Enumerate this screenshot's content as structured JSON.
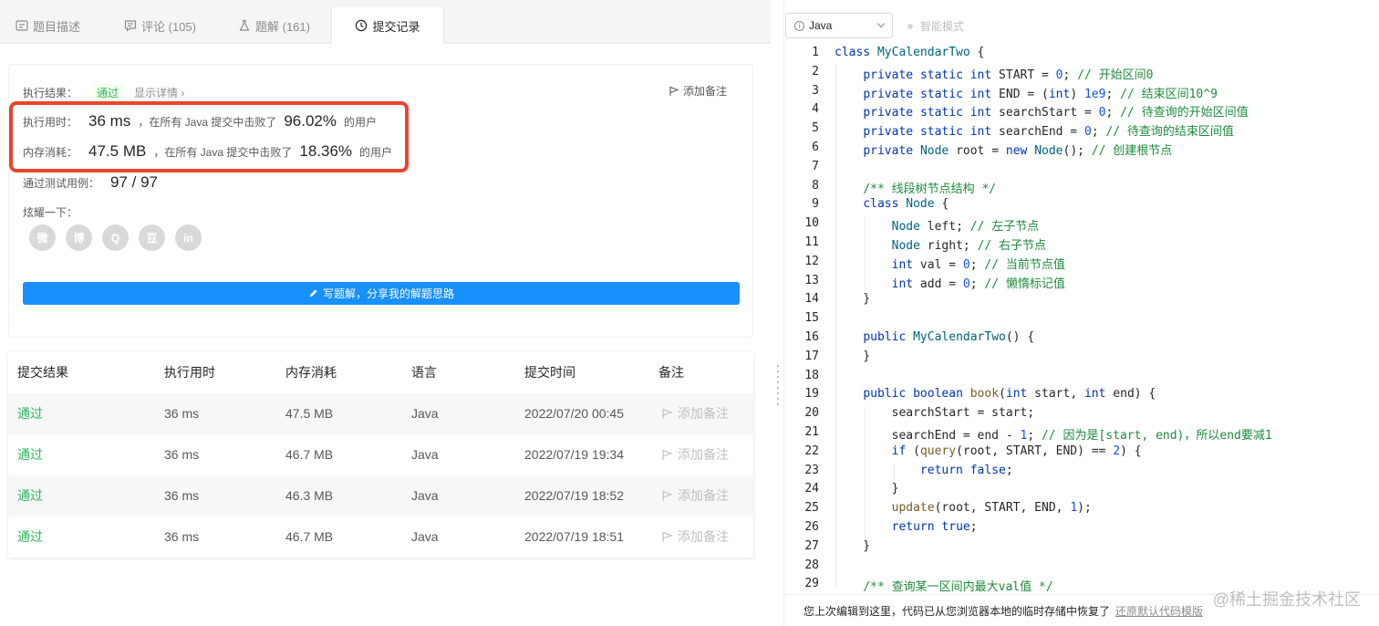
{
  "tabs": [
    {
      "label": "题目描述",
      "icon": "description-icon"
    },
    {
      "label": "评论 (105)",
      "icon": "comment-icon"
    },
    {
      "label": "题解 (161)",
      "icon": "flask-icon"
    },
    {
      "label": "提交记录",
      "icon": "clock-icon",
      "active": true
    }
  ],
  "result": {
    "exec_label": "执行结果：",
    "status": "通过",
    "detail_link": "显示详情 ›",
    "add_note": "添加备注",
    "time_label": "执行用时：",
    "time_value": "36 ms",
    "beat_prefix": "，在所有 Java 提交中击败了",
    "time_pct": "96.02%",
    "beat_suffix": "的用户",
    "mem_label": "内存消耗：",
    "mem_value": "47.5 MB",
    "mem_pct": "18.36%",
    "tests_label": "通过测试用例：",
    "tests_value": "97 / 97",
    "share_label": "炫耀一下：",
    "share_icons": [
      "wechat-icon",
      "weibo-icon",
      "qq-icon",
      "douban-icon",
      "linkedin-icon"
    ],
    "share_glyphs": [
      "微",
      "博",
      "Q",
      "豆",
      "in"
    ],
    "write_button": "写题解，分享我的解题思路"
  },
  "table": {
    "headers": [
      "提交结果",
      "执行用时",
      "内存消耗",
      "语言",
      "提交时间",
      "备注"
    ],
    "rows": [
      {
        "result": "通过",
        "time": "36 ms",
        "memory": "47.5 MB",
        "lang": "Java",
        "submitted": "2022/07/20 00:45",
        "note": "添加备注"
      },
      {
        "result": "通过",
        "time": "36 ms",
        "memory": "46.7 MB",
        "lang": "Java",
        "submitted": "2022/07/19 19:34",
        "note": "添加备注"
      },
      {
        "result": "通过",
        "time": "36 ms",
        "memory": "46.3 MB",
        "lang": "Java",
        "submitted": "2022/07/19 18:52",
        "note": "添加备注"
      },
      {
        "result": "通过",
        "time": "36 ms",
        "memory": "46.7 MB",
        "lang": "Java",
        "submitted": "2022/07/19 18:51",
        "note": "添加备注"
      }
    ]
  },
  "editor": {
    "language": "Java",
    "smart_mode": "智能模式",
    "lines": [
      "class MyCalendarTwo {",
      "    private static int START = 0; // 开始区间0",
      "    private static int END = (int) 1e9; // 结束区间10^9",
      "    private static int searchStart = 0; // 待查询的开始区间值",
      "    private static int searchEnd = 0; // 待查询的结束区间值",
      "    private Node root = new Node(); // 创建根节点",
      "",
      "    /** 线段树节点结构 */",
      "    class Node {",
      "        Node left; // 左子节点",
      "        Node right; // 右子节点",
      "        int val = 0; // 当前节点值",
      "        int add = 0; // 懒惰标记值",
      "    }",
      "",
      "    public MyCalendarTwo() {",
      "    }",
      "",
      "    public boolean book(int start, int end) {",
      "        searchStart = start;",
      "        searchEnd = end - 1; // 因为是[start, end)，所以end要减1",
      "        if (query(root, START, END) == 2) {",
      "            return false;",
      "        }",
      "        update(root, START, END, 1);",
      "        return true;",
      "    }",
      "",
      "    /** 查询某一区间内最大val值 */"
    ],
    "footer_text": "您上次编辑到这里，代码已从您浏览器本地的临时存储中恢复了",
    "footer_link": "还原默认代码模版"
  },
  "watermark": "@稀土掘金技术社区"
}
